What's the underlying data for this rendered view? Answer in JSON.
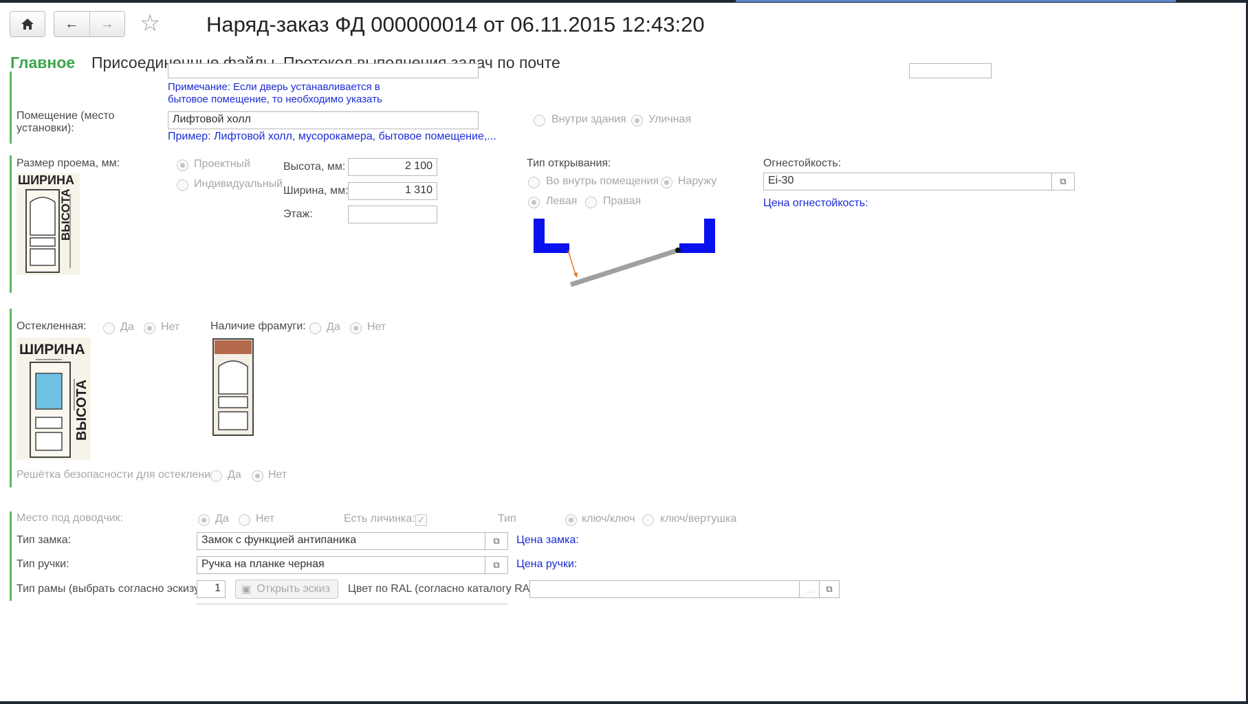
{
  "window": {
    "title": "Наряд-заказ ФД 000000014 от 06.11.2015 12:43:20"
  },
  "tabs": [
    {
      "label": "Главное",
      "active": true
    },
    {
      "label": "Присоединенные файлы",
      "active": false
    },
    {
      "label": "Протокол выполнения задач по почте",
      "active": false
    }
  ],
  "note": {
    "line1": "Примечание: Если дверь устанавливается в",
    "line2": "бытовое помещение, то необходимо указать"
  },
  "room": {
    "label_line1": "Помещение (место",
    "label_line2": "установки):",
    "value": "Лифтовой холл",
    "hint": "Пример: Лифтовой холл, мусорокамера, бытовое помещение,...",
    "inside_label": "Внутри здания",
    "street_label": "Уличная",
    "selected": "Уличная"
  },
  "opening": {
    "label": "Размер проема, мм:",
    "design_label": "Проектный",
    "individual_label": "Индивидуальный",
    "selected": "Проектный",
    "height_label": "Высота, мм:",
    "height_value": "2 100",
    "width_label": "Ширина, мм:",
    "width_value": "1 310",
    "floor_label": "Этаж:",
    "floor_value": "",
    "sketch_width": "ШИРИНА",
    "sketch_height": "ВЫСОТА"
  },
  "open_type": {
    "label": "Тип открывания:",
    "inward_label": "Во внутрь помещения",
    "outward_label": "Наружу",
    "direction_selected": "Наружу",
    "left_label": "Левая",
    "right_label": "Правая",
    "hand_selected": "Левая",
    "colors": {
      "frame": "#0a10ee",
      "leaf": "#a0a0a0",
      "arrow": "#e07a2a"
    }
  },
  "fire": {
    "label": "Огнестойкость:",
    "value": "Ei-30",
    "price_link": "Цена огнестойкость:"
  },
  "glazing": {
    "label": "Остекленная:",
    "yes": "Да",
    "no": "Нет",
    "selected": "Нет",
    "sketch_width": "ШИРИНА",
    "sketch_height": "ВЫСОТА",
    "glass_color": "#6fc1e3"
  },
  "transom": {
    "label": "Наличие фрамуги:",
    "yes": "Да",
    "no": "Нет",
    "selected": "Нет",
    "transom_color": "#b46a4a"
  },
  "grille": {
    "label": "Решётка безопасности для остекления:",
    "yes": "Да",
    "no": "Нет",
    "selected": "Нет"
  },
  "closer": {
    "label": "Место под доводчик:",
    "yes": "Да",
    "no": "Нет",
    "selected": "Да",
    "larva_label": "Есть личинка:",
    "larva_checked": true,
    "type_label": "Тип",
    "key_key": "ключ/ключ",
    "key_turn": "ключ/вертушка",
    "type_selected": "ключ/ключ"
  },
  "lock": {
    "label": "Тип замка:",
    "value": "Замок с функцией антипаника",
    "price_link": "Цена замка:"
  },
  "handle": {
    "label": "Тип ручки:",
    "value": "Ручка на планке черная",
    "price_link": "Цена ручки:"
  },
  "frame": {
    "label": "Тип рамы (выбрать согласно эскизу):",
    "value": "1",
    "open_sketch": "Открыть эскиз",
    "ral_label": "Цвет по RAL (согласно каталогу RAl):",
    "ral_value": ""
  }
}
